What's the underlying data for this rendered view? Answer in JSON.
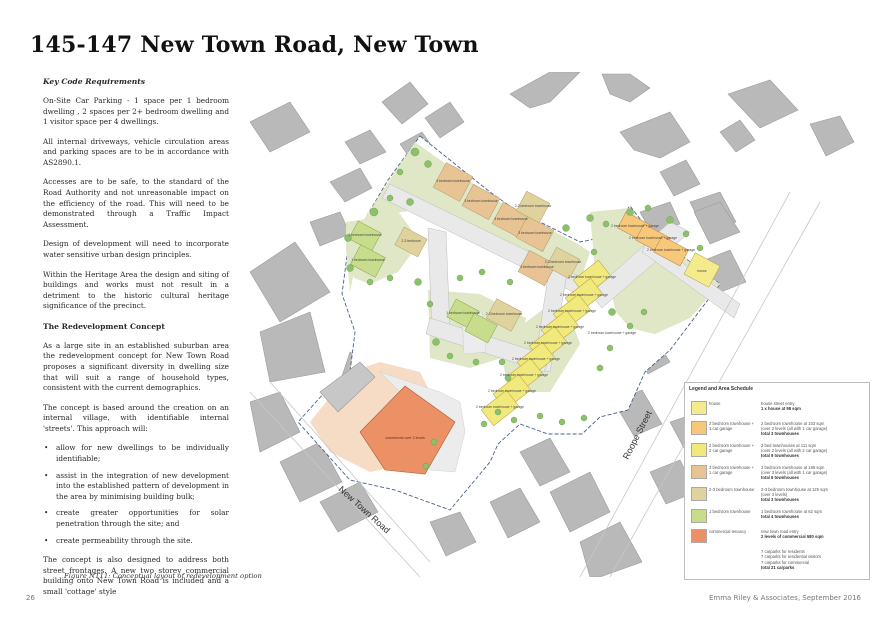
{
  "title": "145-147 New Town Road, New Town",
  "key_code_heading": "Key Code Requirements",
  "paragraphs_1": [
    "On-Site Car Parking - 1 space per 1 bedroom dwelling , 2 spaces per 2+ bedroom dwelling and 1 visitor space per 4 dwellings.",
    "All internal driveways, vehicle circulation areas and parking spaces are to be in accordance with AS2890.1.",
    "Accesses are to be safe, to the standard of the Road Authority and not unreasonable impact on the efficiency of the road. This will need to be demonstrated through a Traffic Impact Assessment.",
    "Design of development will need to incorporate water sensitive urban design principles.",
    "Within the Heritage Area the design and siting of buildings and works must not result in a detriment to the historic cultural heritage significance of the precinct."
  ],
  "concept_heading": "The Redevelopment Concept",
  "paragraphs_2": [
    "As a large site in an established suburban area the redevelopment concept for New Town Road proposes a significant diversity in dwelling size that will suit a range of household types, consistent with the current demographics.",
    "The concept is based around the creation on an internal village, with identifiable internal 'streets'. This approach will:"
  ],
  "bullets": [
    "allow for new dwellings to be individually identifiable;",
    "assist in the integration of new development into the established pattern of development in the area by minimising building bulk;",
    "create greater opportunities for solar penetration through the site; and",
    "create permeability through the site."
  ],
  "paragraph_3": "The concept is also designed to address both street frontages. A new two storey commercial building onto New Town Road is included and a small 'cottage' style",
  "caption": "Figure NT11: Conceptual layout of redevelopment option",
  "page_number": "26",
  "footer": "Emma Riley & Associates, September 2016",
  "map": {
    "street_new_town": "New Town Road",
    "street_roope": "Roope Street",
    "commercial_label": "commercial over 2 levels",
    "unit_labels": [
      "3 bedroom townhouse",
      "3 bedroom townhouse",
      "3 bedroom townhouse",
      "2-3 bedroom townhouse",
      "3 bedroom townhouse",
      "2-3 bedroom townhouse",
      "3 bedroom townhouse",
      "1 bedroom townhouse",
      "2-3 bedroom",
      "1 bedroom townhouse",
      "1 bedroom townhouse",
      "2-3 bedroom townhouse",
      "2 bedroom townhouse + garage",
      "2 bedroom townhouse + garage",
      "2 bedroom townhouse + garage",
      "2 bedroom townhouse + garage",
      "2 bedroom townhouse + garage",
      "2 bedroom townhouse + garage",
      "2 bedroom townhouse + garage",
      "2 bedroom townhouse + garage",
      "2 bedroom townhouse + garage",
      "2 bedroom townhouse + garage",
      "2 bedroom townhouse + garage",
      "2 bedroom townhouse + garage",
      "2 bedroom townhouse + garage",
      "house"
    ]
  },
  "legend": {
    "title": "Legend and Area Schedule",
    "rows": [
      {
        "color": "#f3eb8e",
        "desc": "house",
        "sched_1": "house street entry",
        "sched_2": "1 x house at 98 sqm",
        "sched_3": ""
      },
      {
        "color": "#f7c77a",
        "desc": "2 bedroom townhouse + 1 car garage",
        "sched_1": "2 bedroom townhouse at 103 sqm",
        "sched_2": "(over 2 levels (all with 1 car garage)",
        "sched_3": "total 3 townhouses"
      },
      {
        "color": "#f2e97c",
        "desc": "2 bedroom townhouse + 2 car garage",
        "sched_1": "2 bed townhouses at 111 sqm",
        "sched_2": "(over 2 levels (all with 2 car garage)",
        "sched_3": "total 9 townhouses"
      },
      {
        "color": "#e8c494",
        "desc": "3 bedroom townhouse + 1 car garage",
        "sched_1": "3 bedroom townhouse at 165 sqm",
        "sched_2": "(over 3 levels (all with 1 car garage)",
        "sched_3": "total 6 townhouses"
      },
      {
        "color": "#e0d29d",
        "desc": "2-3 bedroom townhouse",
        "sched_1": "2-3 bedroom townhouse at 125 sqm",
        "sched_2": "(over 3 levels)",
        "sched_3": "total 3 townhouses"
      },
      {
        "color": "#c8dd8c",
        "desc": "1 bedroom townhouse",
        "sched_1": "1 bedroom townhouse at 62 sqm",
        "sched_2": "",
        "sched_3": "total 4 townhouses"
      },
      {
        "color": "#ec9166",
        "desc": "commercial tenancy",
        "sched_1": "new town road entry",
        "sched_2": "2 levels of commercial 580 sqm",
        "sched_3": ""
      }
    ],
    "notes": [
      "7 carparks for residents",
      "7 carparks for residential visitors",
      "7 carparks for commercial",
      "total 21 carparks"
    ]
  }
}
